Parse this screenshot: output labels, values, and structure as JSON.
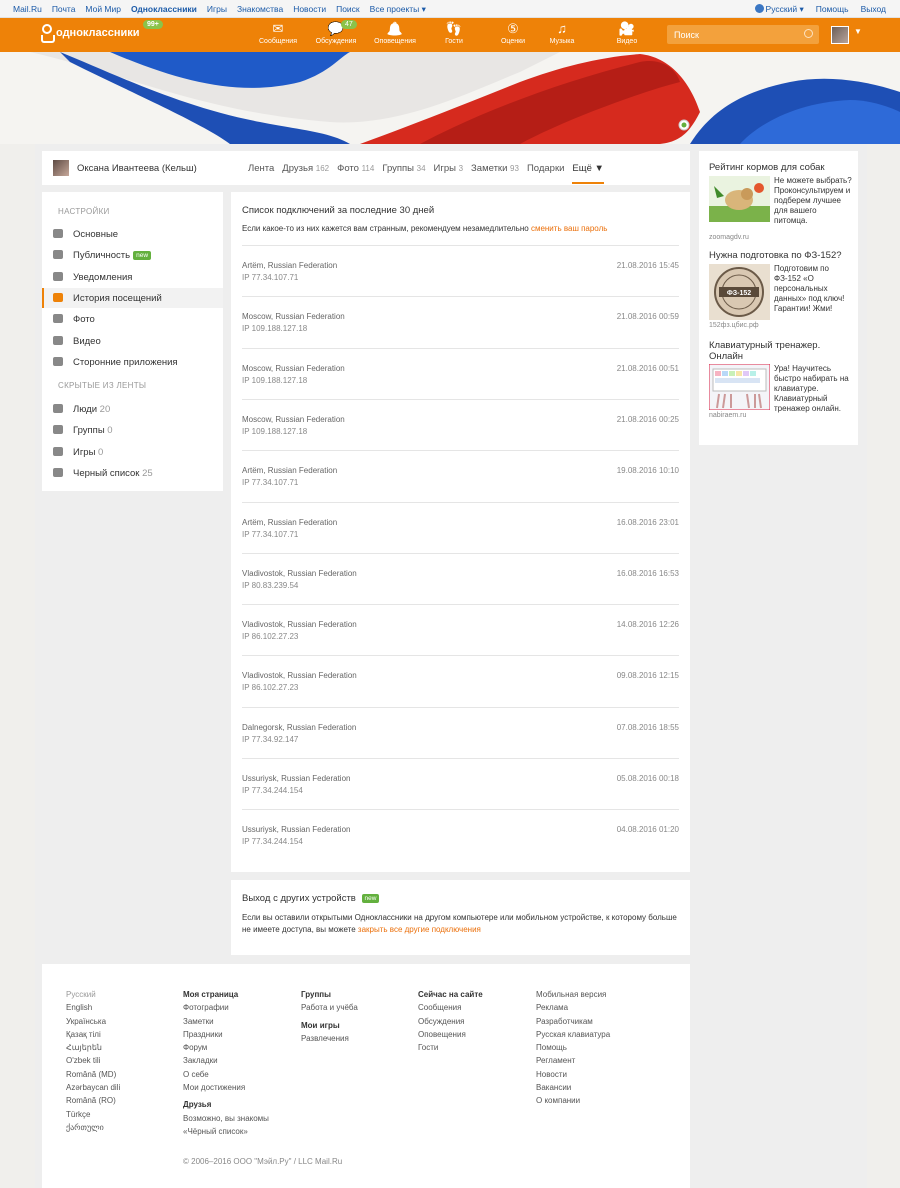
{
  "topbar": {
    "links": [
      "Mail.Ru",
      "Почта",
      "Мой Мир",
      "Одноклассники",
      "Игры",
      "Знакомства",
      "Новости",
      "Поиск",
      "Все проекты ▾"
    ],
    "language": "Русский ▾",
    "help": "Помощь",
    "logout": "Выход"
  },
  "header": {
    "logo_text": "одноклассники",
    "logo_badge": "99+",
    "nav": [
      {
        "label": "Сообщения",
        "icon": "envelope-icon",
        "glyph": "✉"
      },
      {
        "label": "Обсуждения",
        "icon": "chat-icon",
        "glyph": "💬",
        "count": "47"
      },
      {
        "label": "Оповещения",
        "icon": "bell-icon",
        "glyph": "🔔"
      },
      {
        "label": "Гости",
        "icon": "footprints-icon",
        "glyph": "👣"
      },
      {
        "label": "Оценки",
        "icon": "ratings-icon",
        "glyph": "⑤"
      },
      {
        "label": "Музыка",
        "icon": "music-icon",
        "glyph": "♫"
      },
      {
        "label": "Видео",
        "icon": "video-camera-icon",
        "glyph": "🎥"
      }
    ],
    "search_placeholder": "Поиск"
  },
  "profile": {
    "name": "Оксана Ивантеева (Кельш)",
    "tabs": [
      {
        "label": "Лента",
        "count": ""
      },
      {
        "label": "Друзья",
        "count": "162"
      },
      {
        "label": "Фото",
        "count": "114"
      },
      {
        "label": "Группы",
        "count": "34"
      },
      {
        "label": "Игры",
        "count": "3"
      },
      {
        "label": "Заметки",
        "count": "93"
      },
      {
        "label": "Подарки",
        "count": ""
      },
      {
        "label": "Ещё ▼",
        "count": ""
      }
    ]
  },
  "leftmenu": {
    "settings_heading": "НАСТРОЙКИ",
    "settings": [
      {
        "label": "Основные",
        "icon": "gear-icon"
      },
      {
        "label": "Публичность",
        "icon": "megaphone-icon",
        "badge": "new"
      },
      {
        "label": "Уведомления",
        "icon": "notification-icon"
      },
      {
        "label": "История посещений",
        "icon": "history-icon"
      },
      {
        "label": "Фото",
        "icon": "camera-icon"
      },
      {
        "label": "Видео",
        "icon": "film-icon"
      },
      {
        "label": "Сторонние приложения",
        "icon": "apps-icon"
      }
    ],
    "hidden_heading": "СКРЫТЫЕ ИЗ ЛЕНТЫ",
    "hidden": [
      {
        "label": "Люди",
        "count": "20",
        "icon": "people-icon"
      },
      {
        "label": "Группы",
        "count": "0",
        "icon": "groups-icon"
      },
      {
        "label": "Игры",
        "count": "0",
        "icon": "gamepad-icon"
      },
      {
        "label": "Черный список",
        "count": "25",
        "icon": "blacklist-icon"
      }
    ]
  },
  "sessions": {
    "title": "Список подключений за последние 30 дней",
    "hint": "Если какое-то из них кажется вам странным, рекомендуем незамедлительно ",
    "hint_link": "сменить ваш пароль",
    "rows": [
      {
        "location": "Artëm, Russian Federation",
        "ip": "IP 77.34.107.71",
        "date": "21.08.2016 15:45"
      },
      {
        "location": "Moscow, Russian Federation",
        "ip": "IP 109.188.127.18",
        "date": "21.08.2016 00:59"
      },
      {
        "location": "Moscow, Russian Federation",
        "ip": "IP 109.188.127.18",
        "date": "21.08.2016 00:51"
      },
      {
        "location": "Moscow, Russian Federation",
        "ip": "IP 109.188.127.18",
        "date": "21.08.2016 00:25"
      },
      {
        "location": "Artëm, Russian Federation",
        "ip": "IP 77.34.107.71",
        "date": "19.08.2016 10:10"
      },
      {
        "location": "Artëm, Russian Federation",
        "ip": "IP 77.34.107.71",
        "date": "16.08.2016 23:01"
      },
      {
        "location": "Vladivostok, Russian Federation",
        "ip": "IP 80.83.239.54",
        "date": "16.08.2016 16:53"
      },
      {
        "location": "Vladivostok, Russian Federation",
        "ip": "IP 86.102.27.23",
        "date": "14.08.2016 12:26"
      },
      {
        "location": "Vladivostok, Russian Federation",
        "ip": "IP 86.102.27.23",
        "date": "09.08.2016 12:15"
      },
      {
        "location": "Dalnegorsk, Russian Federation",
        "ip": "IP 77.34.92.147",
        "date": "07.08.2016 18:55"
      },
      {
        "location": "Ussuriysk, Russian Federation",
        "ip": "IP 77.34.244.154",
        "date": "05.08.2016 00:18"
      },
      {
        "location": "Ussuriysk, Russian Federation",
        "ip": "IP 77.34.244.154",
        "date": "04.08.2016 01:20"
      }
    ]
  },
  "logout_others": {
    "title": "Выход с других устройств",
    "badge": "new",
    "text": "Если вы оставили открытыми Одноклассники на другом компьютере или мобильном устройстве, к которому больше не имеете доступа, вы можете ",
    "link": "закрыть все другие подключения"
  },
  "ads": [
    {
      "title": "Рейтинг кормов для собак",
      "text": "Не можете выбрать? Проконсультируем и подберем лучшее для вашего питомца.",
      "site": "zoomagdv.ru"
    },
    {
      "title": "Нужна подготовка по ФЗ-152?",
      "text": "Подготовим по ФЗ-152 «О персональных данных» под ключ! Гарантии! Жми!",
      "site": "152фз.цбис.рф",
      "image_text": "ФЗ-152"
    },
    {
      "title": "Клавиатурный тренажер. Онлайн",
      "text": "Ура! Научитесь быстро набирать на клавиатуре. Клавиатурный тренажер онлайн.",
      "site": "nabiraem.ru"
    }
  ],
  "footer": {
    "languages": [
      "Русский",
      "English",
      "Українська",
      "Қазақ тілі",
      "Հայերեն",
      "O'zbek tili",
      "Română (MD)",
      "Azərbaycan dili",
      "Română (RO)",
      "Türkçe",
      "ქართული"
    ],
    "col2_heading": "Моя страница",
    "col2": [
      "Фотографии",
      "Заметки",
      "Праздники",
      "Форум",
      "Закладки",
      "О себе",
      "Мои достижения"
    ],
    "col2b_heading": "Друзья",
    "col2b": [
      "Возможно, вы знакомы",
      "«Чёрный список»"
    ],
    "col3_heading": "Группы",
    "col3": [
      "Работа и учёба"
    ],
    "col3b_heading": "Мои игры",
    "col3b": [
      "Развлечения"
    ],
    "col4_heading": "Сейчас на сайте",
    "col4": [
      "Сообщения",
      "Обсуждения",
      "Оповещения",
      "Гости"
    ],
    "col5": [
      "Мобильная версия",
      "Реклама",
      "Разработчикам",
      "Русская клавиатура",
      "Помощь",
      "Регламент",
      "Новости",
      "Вакансии",
      "О компании"
    ],
    "copyright": "© 2006–2016 ООО \"Мэйл.Ру\" / LLC Mail.Ru"
  },
  "colors": {
    "brand_orange": "#ee8208",
    "link_orange": "#eb6f0a",
    "badge_green": "#63b03e"
  }
}
